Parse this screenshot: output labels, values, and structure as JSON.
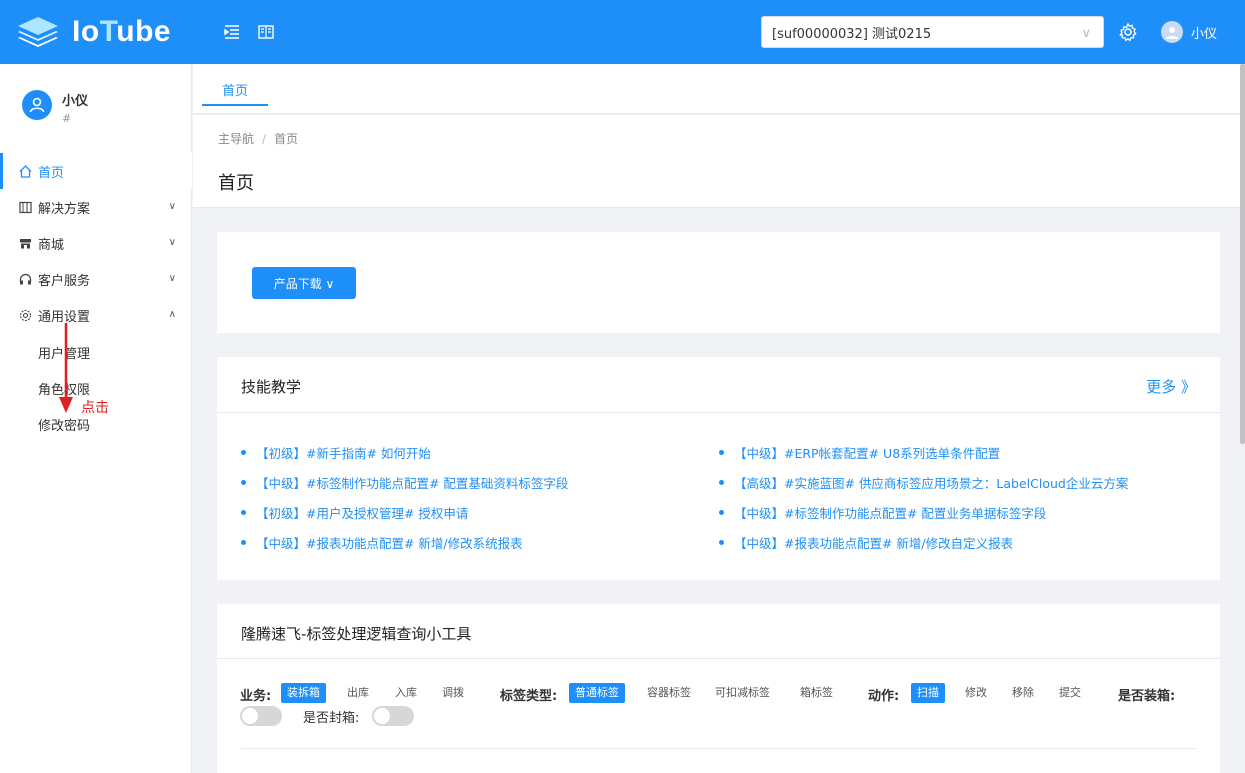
{
  "header": {
    "brand": "IoTube",
    "brand_io": "Io",
    "brand_t": "T",
    "brand_rest": "ube",
    "tenant_value": "[suf00000032] 测试0215",
    "user_name": "小仪",
    "accent": "#1e8ff8"
  },
  "sidebar": {
    "profile_name": "小仪",
    "profile_sub": "#",
    "items": [
      {
        "label": "首页",
        "icon": "home-icon"
      },
      {
        "label": "解决方案",
        "icon": "solution-icon"
      },
      {
        "label": "商城",
        "icon": "shop-icon"
      },
      {
        "label": "客户服务",
        "icon": "headset-icon"
      },
      {
        "label": "通用设置",
        "icon": "gear-icon"
      }
    ],
    "sub_items": [
      "用户管理",
      "角色权限",
      "修改密码"
    ],
    "annotation": "点击"
  },
  "tabs": [
    {
      "label": "首页"
    }
  ],
  "breadcrumb": {
    "root": "主导航",
    "sep": "/",
    "current": "首页"
  },
  "page_title": "首页",
  "download": {
    "label": "产品下载 ∨"
  },
  "skills": {
    "title": "技能教学",
    "more": "更多 》",
    "left": [
      "【初级】#新手指南# 如何开始",
      "【中级】#标签制作功能点配置# 配置基础资料标签字段",
      "【初级】#用户及授权管理# 授权申请",
      "【中级】#报表功能点配置# 新增/修改系统报表"
    ],
    "right": [
      "【中级】#ERP帐套配置# U8系列选单条件配置",
      "【高级】#实施蓝图# 供应商标签应用场景之：LabelCloud企业云方案",
      "【中级】#标签制作功能点配置# 配置业务单据标签字段",
      "【中级】#报表功能点配置# 新增/修改自定义报表"
    ]
  },
  "tool": {
    "title": "隆腾速飞-标签处理逻辑查询小工具",
    "business_label": "业务:",
    "business": [
      "装拆箱",
      "出库",
      "入库",
      "调拨"
    ],
    "label_type_label": "标签类型:",
    "label_types": [
      "普通标签",
      "容器标签",
      "可扣减标签",
      "箱标签"
    ],
    "action_label": "动作:",
    "actions": [
      "扫描",
      "修改",
      "移除",
      "提交"
    ],
    "boxed_label": "是否装箱:",
    "sealed_label": "是否封箱:"
  }
}
